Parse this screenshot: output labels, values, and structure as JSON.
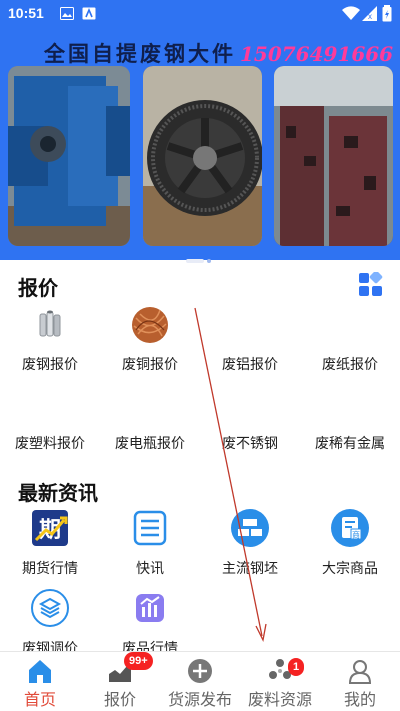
{
  "status_bar": {
    "time": "10:51"
  },
  "banner": {
    "title": "全国自提废钢大件",
    "phone": "15076491666"
  },
  "quotes": {
    "title": "报价",
    "items": [
      {
        "label": "废钢报价",
        "icon": "steel-pipes-icon"
      },
      {
        "label": "废铜报价",
        "icon": "copper-wire-icon"
      },
      {
        "label": "废铝报价",
        "icon": ""
      },
      {
        "label": "废纸报价",
        "icon": ""
      },
      {
        "label": "废塑料报价",
        "icon": ""
      },
      {
        "label": "废电瓶报价",
        "icon": ""
      },
      {
        "label": "废不锈钢",
        "icon": ""
      },
      {
        "label": "废稀有金属",
        "icon": ""
      }
    ]
  },
  "news": {
    "title": "最新资讯",
    "items": [
      {
        "label": "期货行情",
        "icon": "futures-icon"
      },
      {
        "label": "快讯",
        "icon": "flash-news-icon"
      },
      {
        "label": "主流钢坯",
        "icon": "steel-billet-icon"
      },
      {
        "label": "大宗商品",
        "icon": "commodity-icon"
      },
      {
        "label": "废钢调价",
        "icon": "price-adjust-icon"
      },
      {
        "label": "废品行情",
        "icon": "scrap-market-icon"
      }
    ]
  },
  "bottom_nav": {
    "items": [
      {
        "label": "首页",
        "icon": "home-icon",
        "active": true
      },
      {
        "label": "报价",
        "icon": "chart-icon",
        "badge": "99+"
      },
      {
        "label": "货源发布",
        "icon": "plus-circle-icon"
      },
      {
        "label": "废料资源",
        "icon": "resource-icon",
        "badge": "1"
      },
      {
        "label": "我的",
        "icon": "profile-icon"
      }
    ]
  },
  "colors": {
    "primary": "#2f73f2",
    "active": "#e14b3a",
    "badge": "#f52222",
    "icon_blue": "#2a8ee8"
  }
}
